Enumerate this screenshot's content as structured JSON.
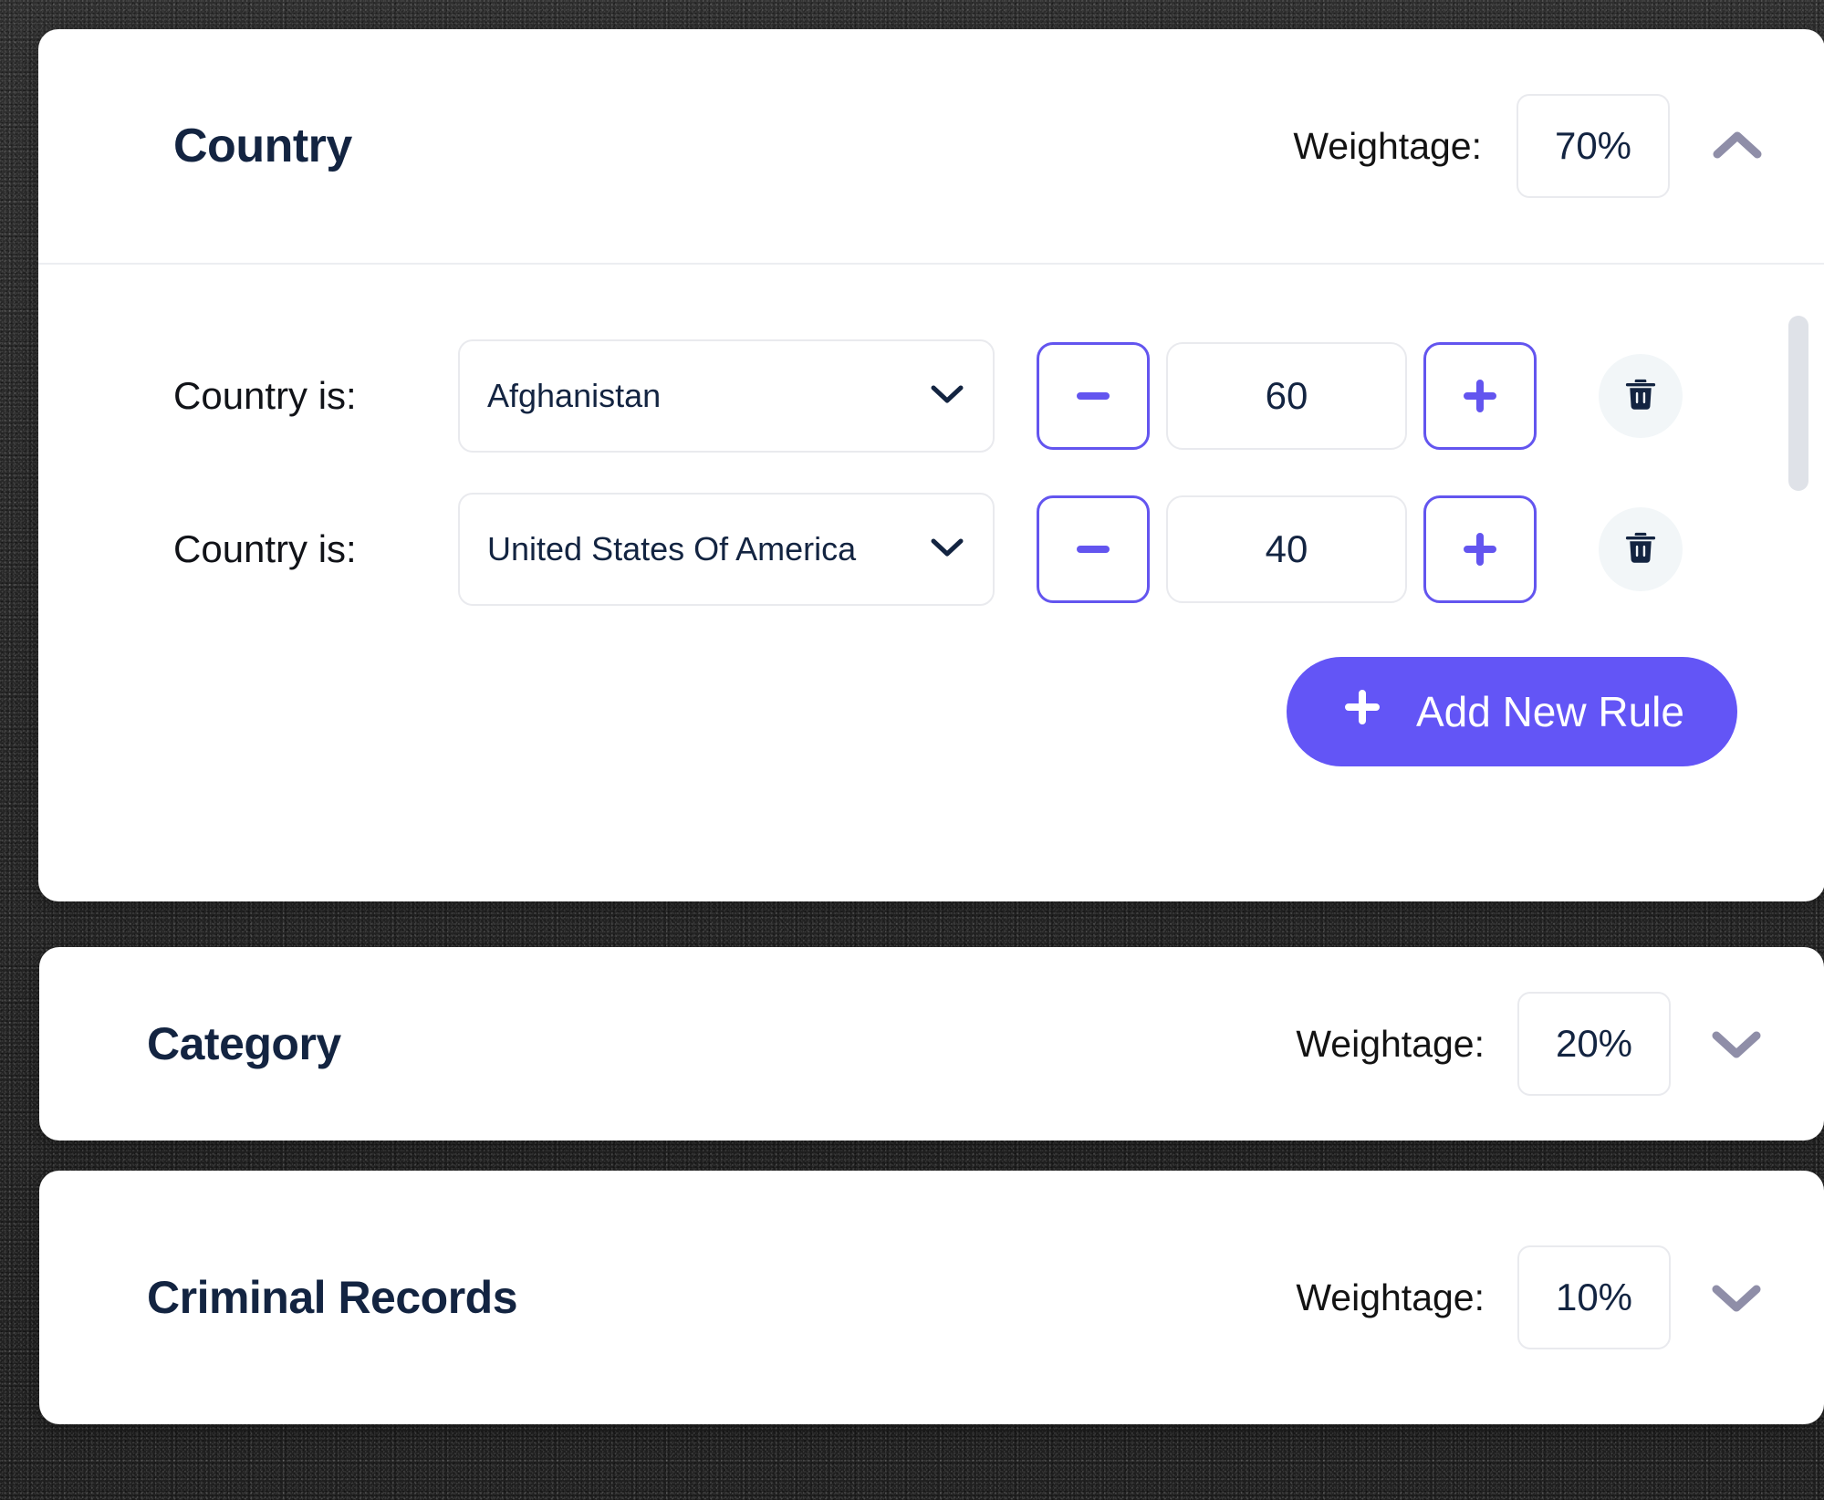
{
  "common": {
    "weightage_label": "Weightage:",
    "accent_color": "#6355f6",
    "title_color": "#132441",
    "delete_icon_color": "#132441"
  },
  "sections": [
    {
      "title": "Country",
      "weightage": "70%",
      "expanded": true,
      "toggle_icon": "chevron-up-icon",
      "rules": [
        {
          "label": "Country is:",
          "selected_option": "Afghanistan",
          "dropdown_icon": "chevron-down-icon",
          "decrement_label": "−",
          "increment_label": "+",
          "value": "60",
          "delete_icon": "trash-icon"
        },
        {
          "label": "Country is:",
          "selected_option": "United States Of America",
          "dropdown_icon": "chevron-down-icon",
          "decrement_label": "−",
          "increment_label": "+",
          "value": "40",
          "delete_icon": "trash-icon"
        }
      ],
      "add_rule_label": "Add New Rule",
      "add_rule_icon": "plus-icon"
    },
    {
      "title": "Category",
      "weightage": "20%",
      "expanded": false,
      "toggle_icon": "chevron-down-icon"
    },
    {
      "title": "Criminal Records",
      "weightage": "10%",
      "expanded": false,
      "toggle_icon": "chevron-down-icon"
    }
  ]
}
